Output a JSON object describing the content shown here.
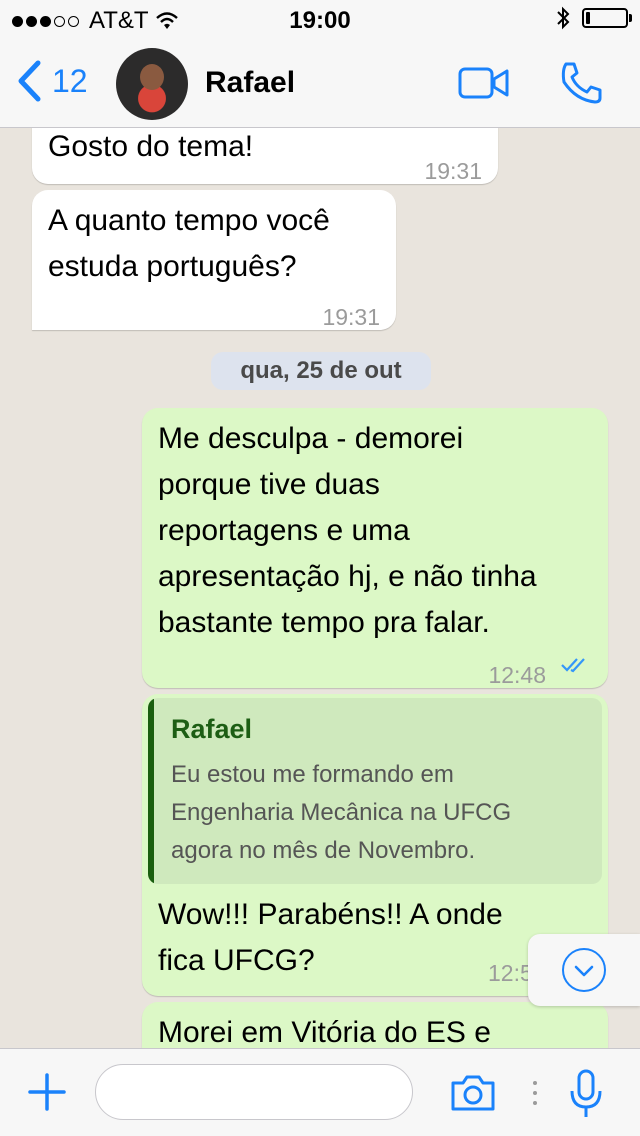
{
  "status_bar": {
    "carrier": "AT&T",
    "signal_bars_filled": 3,
    "signal_bars_total": 5,
    "time": "19:00",
    "battery_level": 0.1
  },
  "nav": {
    "back_count": "12",
    "contact_name": "Rafael",
    "icons": [
      "chevron-left-icon",
      "video-call-icon",
      "phone-icon"
    ]
  },
  "messages": [
    {
      "direction": "in",
      "text": "Gosto do tema!",
      "time": "19:31"
    },
    {
      "direction": "in",
      "lines": [
        "A quanto tempo você",
        "estuda português?"
      ],
      "time": "19:31"
    },
    {
      "type": "date",
      "label": "qua, 25 de out"
    },
    {
      "direction": "out",
      "lines": [
        "Me desculpa - demorei",
        "porque tive duas",
        "reportagens e uma",
        "apresentação hj, e não tinha",
        "bastante tempo pra falar."
      ],
      "time": "12:48",
      "status": "read"
    },
    {
      "direction": "out",
      "quote": {
        "author": "Rafael",
        "lines": [
          "Eu estou me formando em",
          "Engenharia Mecânica na UFCG",
          "agora no mês de Novembro."
        ]
      },
      "lines": [
        "Wow!!! Parabéns!! A onde",
        "fica UFCG?"
      ],
      "time": "12:5"
    },
    {
      "direction": "out",
      "lines": [
        "Morei em Vitória do ES e"
      ]
    }
  ],
  "input": {
    "placeholder": "",
    "icons": [
      "plus-icon",
      "camera-icon",
      "microphone-icon"
    ]
  },
  "colors": {
    "accent": "#1a82fb",
    "outgoing_bubble": "#dcf8c6",
    "incoming_bubble": "#ffffff",
    "background": "#e9e4dd",
    "quote_bar": "#1a5e0f"
  }
}
